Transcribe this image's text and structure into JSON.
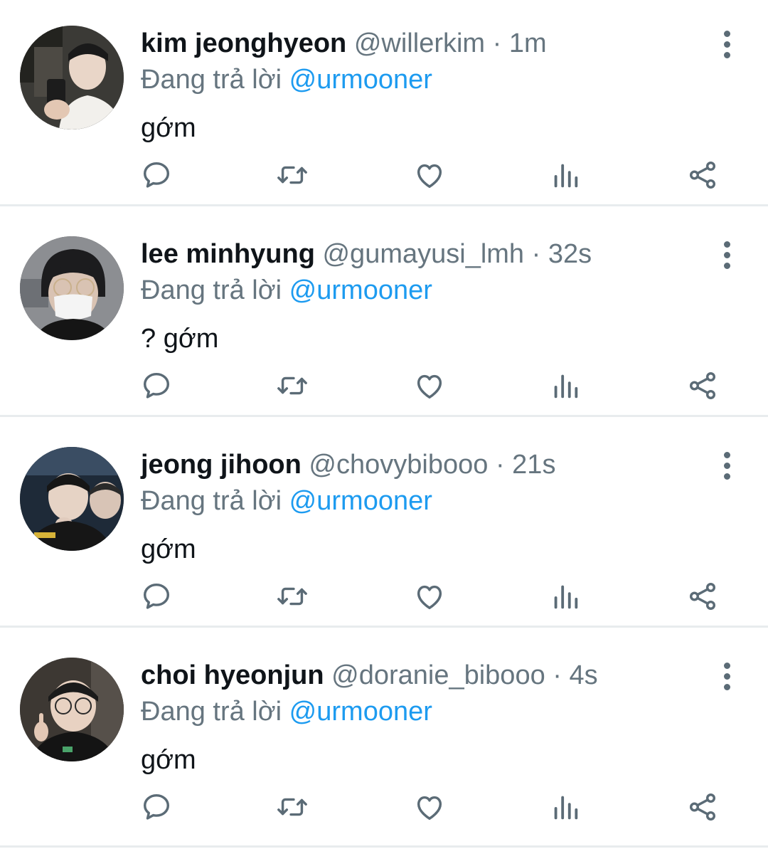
{
  "icons": {
    "reply": "reply-icon",
    "retweet": "retweet-icon",
    "like": "heart-icon",
    "stats": "views-icon",
    "share": "share-icon",
    "more": "more-vertical-icon"
  },
  "colors": {
    "mention": "#1d9bf0",
    "muted": "#66757f",
    "icon": "#5b6b76"
  },
  "tweets": [
    {
      "name": "kim jeonghyeon",
      "handle": "@willerkim",
      "sep": " · ",
      "time": "1m",
      "reply_prefix": "Đang trả lời ",
      "reply_to": "@urmooner",
      "text": "gớm"
    },
    {
      "name": "lee minhyung",
      "handle": "@gumayusi_lmh",
      "sep": " · ",
      "time": "32s",
      "reply_prefix": "Đang trả lời ",
      "reply_to": "@urmooner",
      "text": "? gớm"
    },
    {
      "name": "jeong jihoon",
      "handle": "@chovybibooo",
      "sep": " · ",
      "time": "21s",
      "reply_prefix": "Đang trả lời ",
      "reply_to": "@urmooner",
      "text": "gớm"
    },
    {
      "name": "choi hyeonjun",
      "handle": "@doranie_bibooo",
      "sep": " · ",
      "time": "4s",
      "reply_prefix": "Đang trả lời ",
      "reply_to": "@urmooner",
      "text": "gớm"
    }
  ]
}
